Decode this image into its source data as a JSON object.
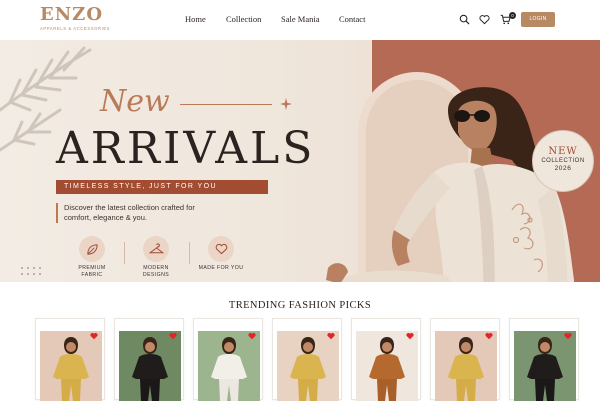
{
  "brand": {
    "logo_main": "ENZO",
    "logo_sub": "APPARELS & ACCESSORIES",
    "accent_color": "#b88a63"
  },
  "nav": {
    "items": [
      "Home",
      "Collection",
      "Sale Mania",
      "Contact"
    ]
  },
  "header_icons": [
    "search-icon",
    "heart-icon",
    "cart-icon"
  ],
  "cart": {
    "count": "0"
  },
  "login_label": "LOGIN",
  "hero": {
    "script_word": "New",
    "headline": "ARRIVALS",
    "tagline": "TIMELESS STYLE, JUST FOR YOU",
    "description": "Discover the latest collection crafted for comfort, elegance & you.",
    "features": [
      {
        "icon": "leaf-icon",
        "label": "PREMIUM FABRIC"
      },
      {
        "icon": "hanger-icon",
        "label": "MODERN DESIGNS"
      },
      {
        "icon": "heart-outline-icon",
        "label": "MADE FOR YOU"
      }
    ],
    "badge": {
      "line1": "NEW",
      "line2": "COLLECTION",
      "line3": "2026"
    },
    "colors": {
      "terracotta": "#b56a55",
      "tagline_bg": "#a24c32",
      "cream": "#f3ece4"
    }
  },
  "trending": {
    "title": "TRENDING FASHION PICKS",
    "products": [
      {
        "outfit": "mustard-coord",
        "bg": "#e4c9b8"
      },
      {
        "outfit": "black-coord",
        "bg": "#6f8a63"
      },
      {
        "outfit": "white-coord",
        "bg": "#9cb58e"
      },
      {
        "outfit": "mustard-coord",
        "bg": "#e8d3c2"
      },
      {
        "outfit": "rust-coord",
        "bg": "#efe7de"
      },
      {
        "outfit": "mustard-coord",
        "bg": "#e4c9b8"
      },
      {
        "outfit": "black-coord",
        "bg": "#7b9570"
      }
    ]
  }
}
